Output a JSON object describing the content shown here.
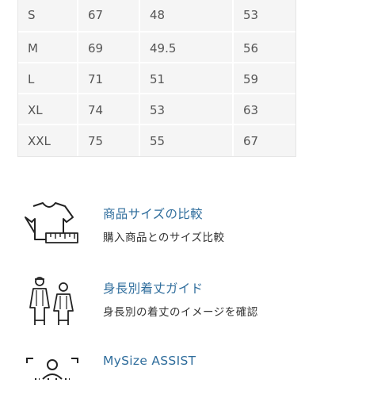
{
  "size_table": {
    "rows": [
      [
        "S",
        "67",
        "48",
        "53"
      ],
      [
        "M",
        "69",
        "49.5",
        "56"
      ],
      [
        "L",
        "71",
        "51",
        "59"
      ],
      [
        "XL",
        "74",
        "53",
        "63"
      ],
      [
        "XXL",
        "75",
        "55",
        "67"
      ]
    ]
  },
  "features": [
    {
      "title": "商品サイズの比較",
      "description": "購入商品とのサイズ比較",
      "icon": "tshirt-ruler-icon"
    },
    {
      "title": "身長別着丈ガイド",
      "description": "身長別の着丈のイメージを確認",
      "icon": "people-figures-icon"
    },
    {
      "title": "MySize ASSIST",
      "description": "",
      "icon": "body-scan-icon"
    }
  ],
  "colors": {
    "link": "#2f6d9c",
    "table_bg": "#f5f5f5",
    "text": "#555555"
  }
}
